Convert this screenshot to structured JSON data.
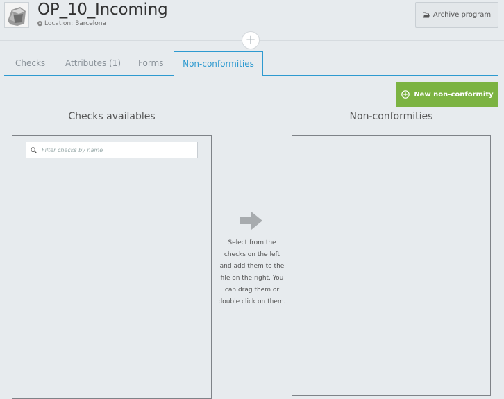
{
  "header": {
    "title": "OP_10_Incoming",
    "location_label": "Location:",
    "location_value": "Barcelona",
    "archive_button": "Archive program"
  },
  "tabs": [
    {
      "label": "Checks",
      "active": false
    },
    {
      "label": "Attributes (1)",
      "active": false
    },
    {
      "label": "Forms",
      "active": false
    },
    {
      "label": "Non-conformities",
      "active": true
    }
  ],
  "actions": {
    "new_nonconformity": "New non-conformity"
  },
  "left_panel": {
    "title": "Checks availables",
    "filter_placeholder": "Filter checks by name"
  },
  "right_panel": {
    "title": "Non-conformities"
  },
  "hint": {
    "text": "Select from the checks on the left and add them to the file on the right. You can drag them or double click on them."
  },
  "colors": {
    "accent": "#2e9ad0",
    "success": "#7cb342",
    "background": "#e7ebee"
  },
  "icons": {
    "location": "map-pin-icon",
    "archive": "folder-icon",
    "add": "plus-icon",
    "search": "search-icon",
    "new": "plus-circle-icon",
    "arrow": "arrow-right-icon"
  }
}
